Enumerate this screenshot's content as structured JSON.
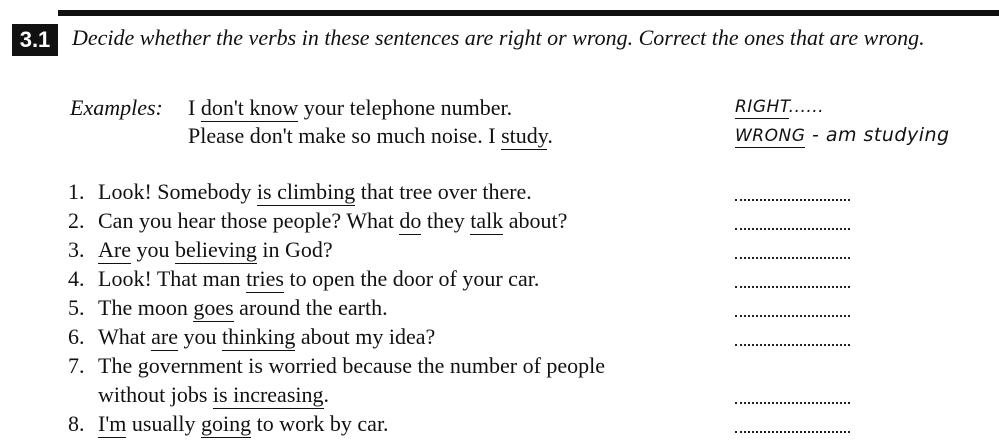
{
  "exercise": {
    "number": "3.1",
    "instruction": "Decide whether the verbs in these sentences are right or wrong. Correct the ones that are wrong."
  },
  "examples": {
    "label": "Examples:",
    "lines": [
      {
        "before": "I ",
        "verb": "don't know",
        "after": " your telephone number."
      },
      {
        "before": "Please don't make so much noise. I ",
        "verb": "study",
        "after": "."
      }
    ],
    "answers": [
      {
        "text": "RIGHT",
        "suffix": "......"
      },
      {
        "text": "WRONG",
        "suffix": " - am studying"
      }
    ]
  },
  "items": [
    {
      "num": "1.",
      "parts": [
        "Look! Somebody ",
        "is climbing",
        " that tree over there."
      ]
    },
    {
      "num": "2.",
      "parts": [
        "Can you hear those people? What ",
        "do",
        " they ",
        "talk",
        " about?"
      ]
    },
    {
      "num": "3.",
      "parts": [
        "",
        "Are",
        " you ",
        "believing",
        " in God?"
      ]
    },
    {
      "num": "4.",
      "parts": [
        "Look! That man ",
        "tries",
        " to open the door of your car."
      ]
    },
    {
      "num": "5.",
      "parts": [
        "The moon ",
        "goes",
        " around the earth."
      ]
    },
    {
      "num": "6.",
      "parts": [
        "What ",
        "are",
        " you ",
        "thinking",
        " about my idea?"
      ]
    },
    {
      "num": "7.",
      "line1": "The government is worried because the number of people",
      "parts": [
        "without jobs ",
        "is increasing",
        "."
      ]
    },
    {
      "num": "8.",
      "parts": [
        "",
        "I'm",
        " usually ",
        "going",
        " to work by car."
      ]
    }
  ]
}
